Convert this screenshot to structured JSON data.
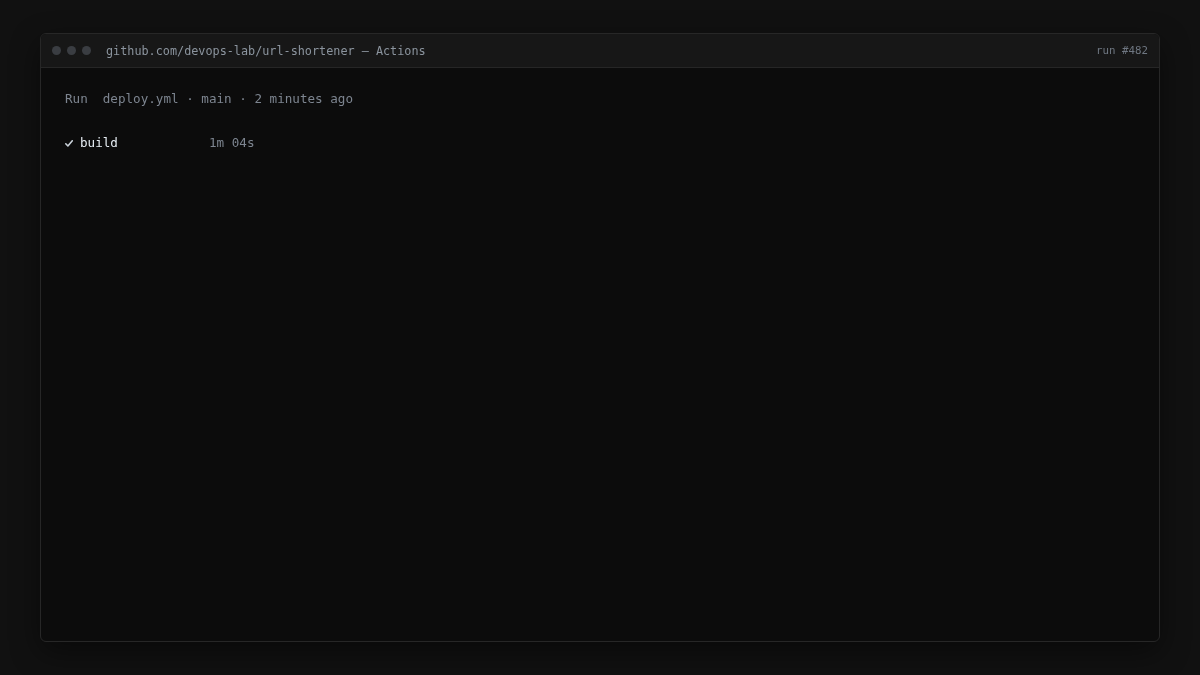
{
  "window": {
    "title": "github.com/devops-lab/url-shortener — Actions",
    "run_number": "run #482"
  },
  "run": {
    "label": "Run",
    "details": "deploy.yml · main · 2 minutes ago"
  },
  "jobs": [
    {
      "name": "build",
      "passed": true,
      "duration": "1m 04s"
    }
  ]
}
